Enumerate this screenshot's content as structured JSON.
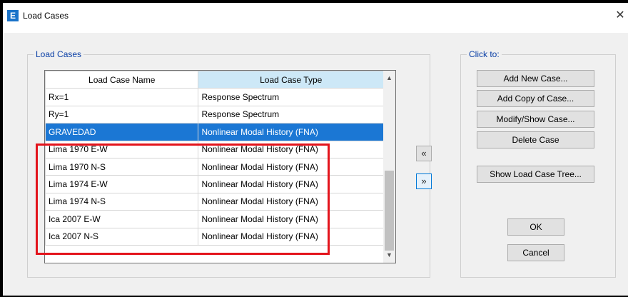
{
  "window": {
    "title": "Load Cases",
    "app_icon": "E"
  },
  "load_cases_group": {
    "label": "Load Cases"
  },
  "table": {
    "columns": [
      "Load Case Name",
      "Load Case Type"
    ],
    "rows": [
      {
        "name": "Rx=1",
        "type": "Response Spectrum"
      },
      {
        "name": "Ry=1",
        "type": "Response Spectrum"
      },
      {
        "name": "GRAVEDAD",
        "type": "Nonlinear Modal History (FNA)"
      },
      {
        "name": "Lima 1970 E-W",
        "type": "Nonlinear Modal History (FNA)"
      },
      {
        "name": "Lima 1970 N-S",
        "type": "Nonlinear Modal History (FNA)"
      },
      {
        "name": "Lima 1974 E-W",
        "type": "Nonlinear Modal History (FNA)"
      },
      {
        "name": "Lima 1974 N-S",
        "type": "Nonlinear Modal History (FNA)"
      },
      {
        "name": "Ica 2007 E-W",
        "type": "Nonlinear Modal History (FNA)"
      },
      {
        "name": "Ica 2007 N-S",
        "type": "Nonlinear Modal History (FNA)"
      }
    ]
  },
  "move_buttons": {
    "up": "«",
    "down": "»"
  },
  "click_to_group": {
    "label": "Click to:"
  },
  "buttons": {
    "add_new": "Add New Case...",
    "add_copy": "Add Copy of Case...",
    "modify_show": "Modify/Show Case...",
    "delete": "Delete Case",
    "show_tree": "Show Load Case Tree...",
    "ok": "OK",
    "cancel": "Cancel"
  },
  "colors": {
    "selection": "#1b77d4",
    "annotation_box": "#e3141c",
    "group_label": "#0a3fa6"
  }
}
